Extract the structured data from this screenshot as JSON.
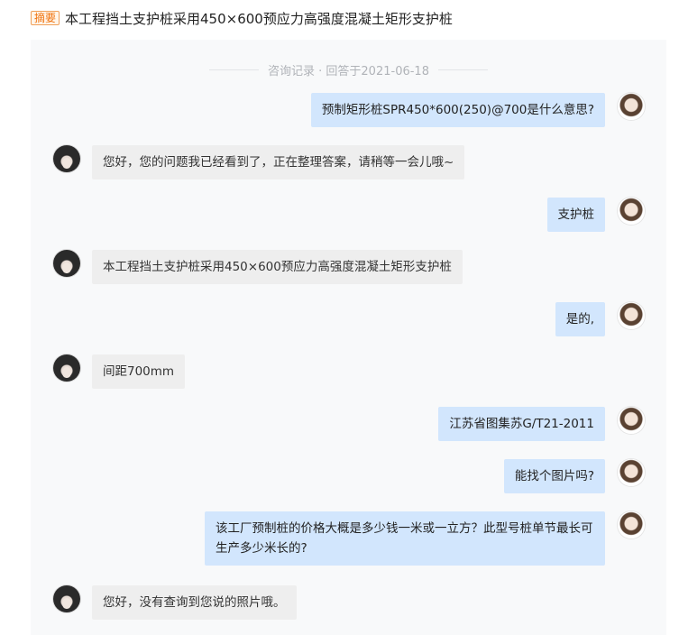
{
  "header": {
    "tag": "摘要",
    "title": "本工程挡土支护桩采用450×600预应力高强度混凝土矩形支护桩"
  },
  "record_label": "咨询记录 · 回答于2021-06-18",
  "messages": [
    {
      "role": "user",
      "text": "预制矩形桩SPR450*600(250)@700是什么意思?"
    },
    {
      "role": "agent",
      "text": "您好，您的问题我已经看到了，正在整理答案，请稍等一会儿哦~"
    },
    {
      "role": "user",
      "text": "支护桩"
    },
    {
      "role": "agent",
      "text": "本工程挡土支护桩采用450×600预应力高强度混凝土矩形支护桩"
    },
    {
      "role": "user",
      "text": "是的,"
    },
    {
      "role": "agent",
      "text": "间距700mm"
    },
    {
      "role": "user",
      "text": "江苏省图集苏G/T21-2011"
    },
    {
      "role": "user",
      "text": "能找个图片吗?"
    },
    {
      "role": "user",
      "text": "该工厂预制桩的价格大概是多少钱一米或一立方？此型号桩单节最长可生产多少米长的?"
    },
    {
      "role": "agent",
      "text": "您好，没有查询到您说的照片哦。"
    }
  ]
}
